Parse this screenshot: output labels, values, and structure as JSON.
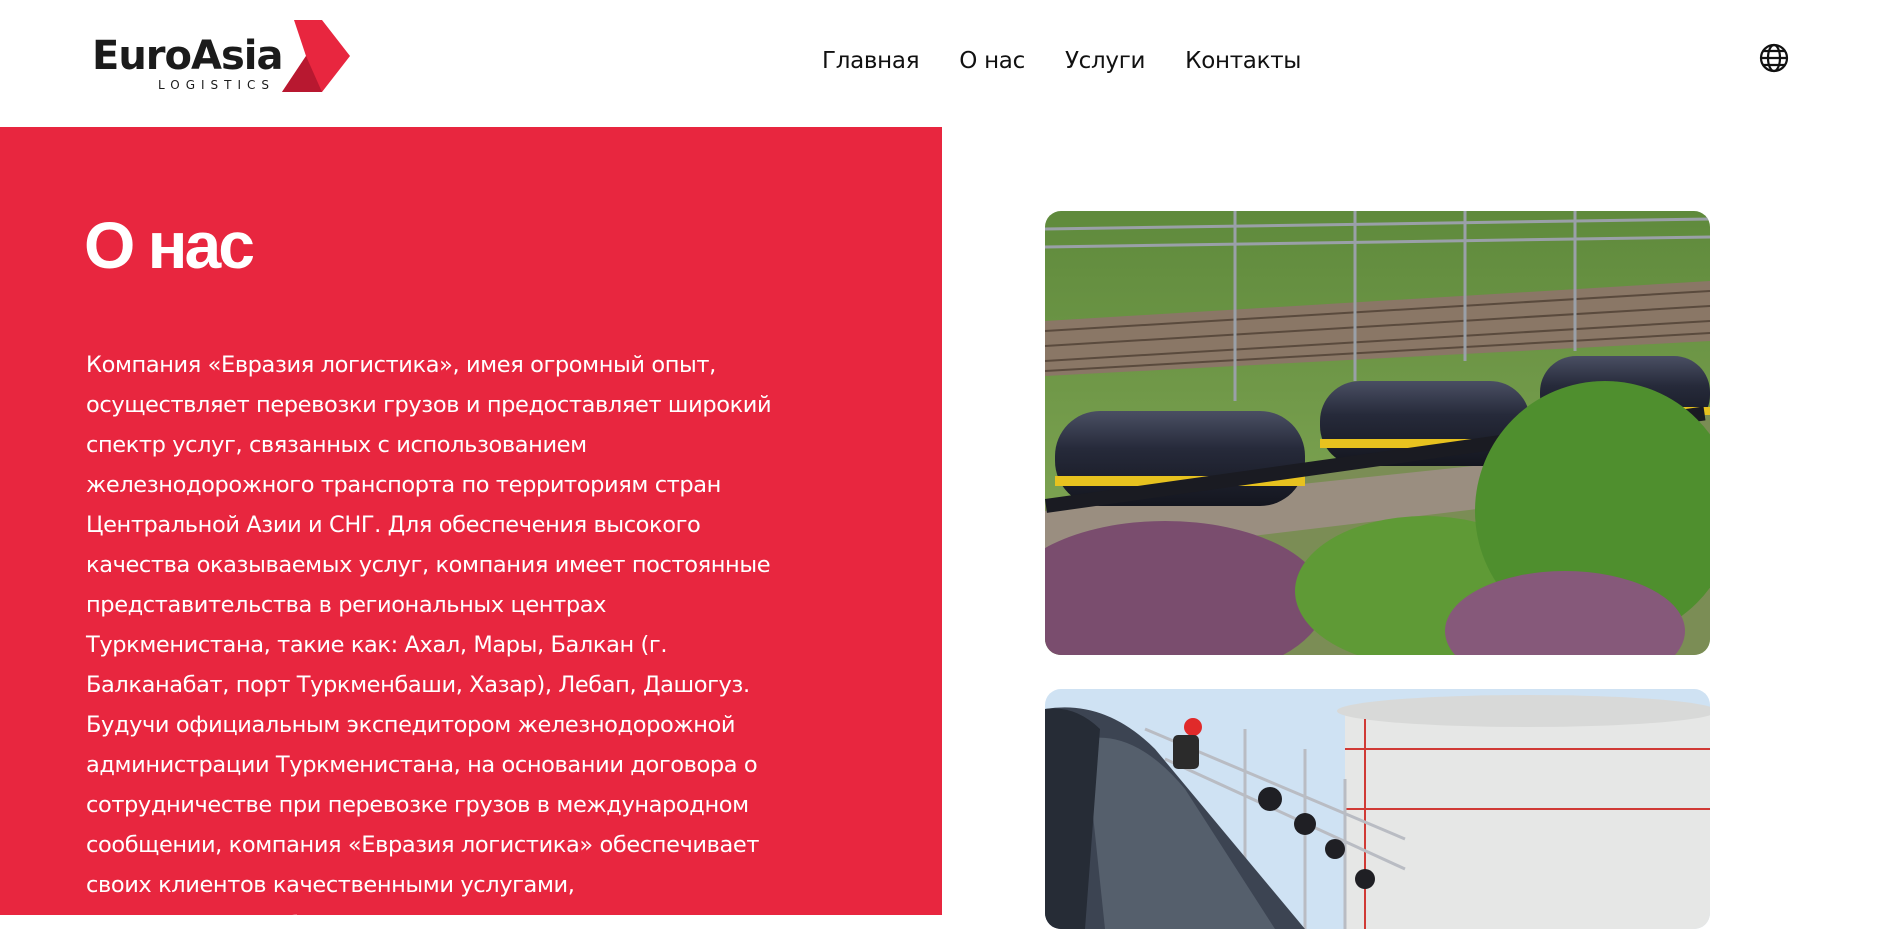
{
  "header": {
    "logo": {
      "word_part1": "Euro",
      "word_part2": "Asia",
      "subtitle": "LOGISTICS",
      "brand_color": "#e8263f"
    },
    "nav": [
      {
        "label": "Главная"
      },
      {
        "label": "О нас"
      },
      {
        "label": "Услуги"
      },
      {
        "label": "Контакты"
      }
    ],
    "language_icon": "globe-icon"
  },
  "about": {
    "title": "О нас",
    "text": "Компания «Евразия логистика», имея огромный опыт, осуществляет перевозки грузов и предоставляет широкий спектр услуг, связанных с использованием железнодорожного транспорта по территориям стран Центральной Азии и СНГ. Для обеспечения высокого качества оказываемых услуг, компания имеет постоянные представительства в региональных центрах Туркменистана, такие как: Ахал, Мары, Балкан (г. Балканабат, порт Туркменбаши, Хазар), Лебап, Дашогуз. Будучи официальным экспедитором железнодорожной администрации Туркменистана, на основании договора о сотрудничестве при перевозке грузов в международном сообщении, компания «Евразия логистика» обеспечивает своих клиентов качественными услугами, конкурентоспособными ставками и актуальной",
    "panel_color": "#e8263f"
  },
  "images": [
    {
      "name": "tank-wagons-train-photo"
    },
    {
      "name": "tank-wagons-loading-photo"
    }
  ]
}
